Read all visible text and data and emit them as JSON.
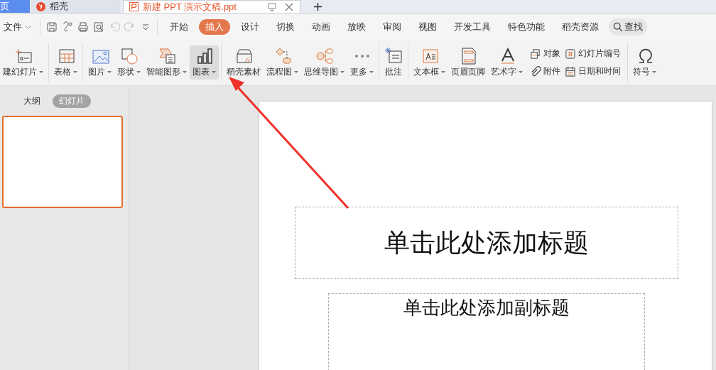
{
  "window_tabs": [
    {
      "label": "页",
      "kind": "home",
      "selected": false
    },
    {
      "label": "稻壳",
      "kind": "docer",
      "selected": false
    },
    {
      "label": "新建 PPT 演示文稿.ppt",
      "kind": "doc",
      "selected": true
    }
  ],
  "menu": {
    "file": "文件",
    "tabs": [
      {
        "label": "开始",
        "selected": false
      },
      {
        "label": "插入",
        "selected": true
      },
      {
        "label": "设计",
        "selected": false
      },
      {
        "label": "切换",
        "selected": false
      },
      {
        "label": "动画",
        "selected": false
      },
      {
        "label": "放映",
        "selected": false
      },
      {
        "label": "审阅",
        "selected": false
      },
      {
        "label": "视图",
        "selected": false
      },
      {
        "label": "开发工具",
        "selected": false
      },
      {
        "label": "特色功能",
        "selected": false
      },
      {
        "label": "稻壳资源",
        "selected": false
      }
    ],
    "search": "查找"
  },
  "ribbon": {
    "groups": [
      {
        "items": [
          {
            "kind": "large",
            "label": "建幻灯片",
            "caret": true,
            "selected": false
          }
        ]
      },
      {
        "items": [
          {
            "kind": "large",
            "label": "表格",
            "caret": true,
            "selected": false
          }
        ]
      },
      {
        "items": [
          {
            "kind": "large",
            "label": "图片",
            "caret": true,
            "selected": false
          },
          {
            "kind": "large",
            "label": "形状",
            "caret": true,
            "selected": false
          },
          {
            "kind": "large",
            "label": "智能图形",
            "caret": true,
            "selected": false
          },
          {
            "kind": "large",
            "label": "图表",
            "caret": true,
            "selected": true
          }
        ]
      },
      {
        "items": [
          {
            "kind": "large",
            "label": "稻壳素材",
            "caret": false,
            "selected": false
          },
          {
            "kind": "large",
            "label": "流程图",
            "caret": true,
            "selected": false
          },
          {
            "kind": "large",
            "label": "思维导图",
            "caret": true,
            "selected": false
          },
          {
            "kind": "large",
            "label": "更多",
            "caret": true,
            "selected": false
          }
        ]
      },
      {
        "items": [
          {
            "kind": "large",
            "label": "批注",
            "caret": false,
            "selected": false
          }
        ]
      },
      {
        "items": [
          {
            "kind": "large",
            "label": "文本框",
            "caret": true,
            "selected": false
          },
          {
            "kind": "large",
            "label": "页眉页脚",
            "caret": false,
            "selected": false
          },
          {
            "kind": "large",
            "label": "艺术字",
            "caret": true,
            "selected": false
          },
          {
            "kind": "small-grid",
            "items": [
              "对象",
              "幻灯片编号",
              "附件",
              "日期和时间"
            ]
          }
        ]
      },
      {
        "items": [
          {
            "kind": "large",
            "label": "符号",
            "caret": true,
            "selected": false
          }
        ]
      }
    ]
  },
  "left_panel": {
    "tabs": [
      {
        "label": "大纲",
        "selected": false
      },
      {
        "label": "幻灯片",
        "selected": true
      }
    ],
    "thumbnails": [
      {
        "selected": true
      }
    ]
  },
  "slide": {
    "title_placeholder": "单击此处添加标题",
    "subtitle_placeholder": "单击此处添加副标题"
  }
}
